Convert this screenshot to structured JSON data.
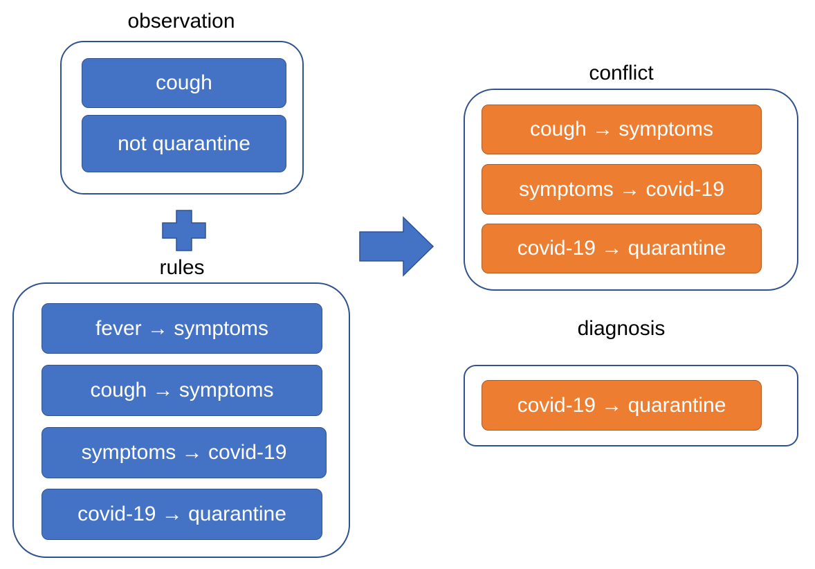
{
  "colors": {
    "observation_fill": "#4472c4",
    "observation_border": "#2f528f",
    "conflict_fill": "#ed7d31",
    "conflict_border": "#ae5a21",
    "group_border": "#2f528f",
    "text_on_fill": "#ffffff",
    "title_text": "#000000"
  },
  "observation": {
    "title": "observation",
    "items": [
      "cough",
      "not quarantine"
    ]
  },
  "plus": {
    "icon": "plus-icon"
  },
  "rules": {
    "title": "rules",
    "items": [
      "fever → symptoms",
      "cough → symptoms",
      "symptoms → covid-19",
      "covid-19 → quarantine"
    ]
  },
  "arrow": {
    "icon": "right-arrow-icon"
  },
  "conflict": {
    "title": "conflict",
    "items": [
      "cough → symptoms",
      "symptoms → covid-19",
      "covid-19 → quarantine"
    ]
  },
  "diagnosis": {
    "title": "diagnosis",
    "items": [
      "covid-19 → quarantine"
    ]
  }
}
